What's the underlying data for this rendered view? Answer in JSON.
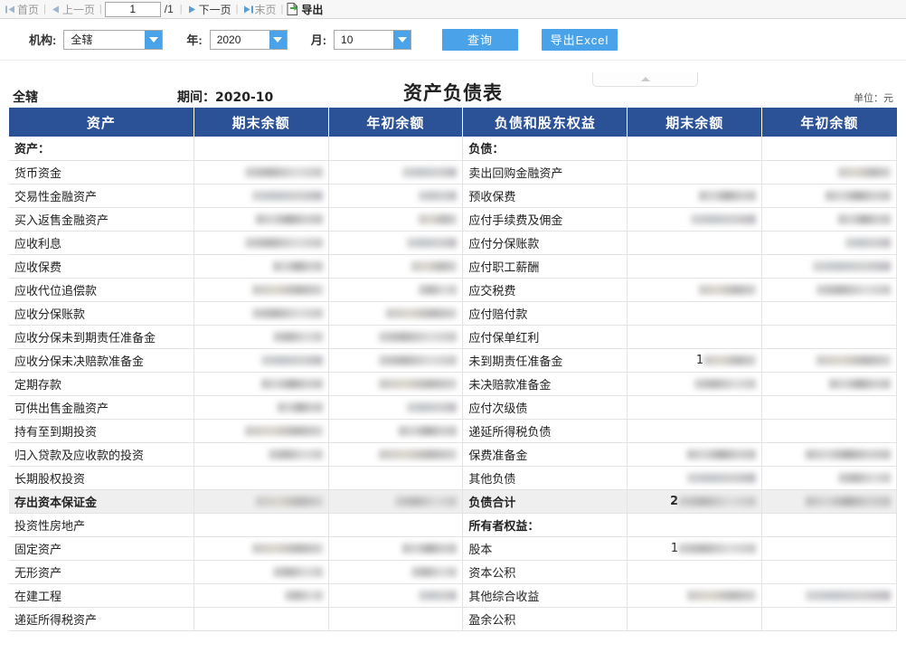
{
  "pager": {
    "first_label": "首页",
    "prev_label": "上一页",
    "page_value": "1",
    "total_pages": "/1",
    "next_label": "下一页",
    "last_label": "末页",
    "export_label": "导出"
  },
  "filters": {
    "org_label": "机构:",
    "org_value": "全辖",
    "year_label": "年:",
    "year_value": "2020",
    "month_label": "月:",
    "month_value": "10",
    "query_button": "查询",
    "export_excel_button": "导出Excel"
  },
  "report": {
    "org_name": "全辖",
    "period_label": "期间：2020-10",
    "title": "资产负债表",
    "unit_label": "单位：元",
    "columns": [
      "资产",
      "期末余额",
      "年初余额",
      "负债和股东权益",
      "期末余额",
      "年初余额"
    ],
    "rows": [
      {
        "asset": "资产：",
        "asset_type": "section",
        "a_end": "",
        "a_begin": "",
        "liab": "负债：",
        "liab_type": "section",
        "l_end": "",
        "l_begin": ""
      },
      {
        "asset": "货币资金",
        "asset_type": "item",
        "a_end": "redacted",
        "a_begin": "redacted",
        "liab": "卖出回购金融资产",
        "liab_type": "item",
        "l_end": "",
        "l_begin": "redacted"
      },
      {
        "asset": "交易性金融资产",
        "asset_type": "item",
        "a_end": "redacted",
        "a_begin": "redacted",
        "liab": "预收保费",
        "liab_type": "item",
        "l_end": "redacted",
        "l_begin": "redacted"
      },
      {
        "asset": "买入返售金融资产",
        "asset_type": "item",
        "a_end": "redacted",
        "a_begin": "redacted",
        "liab": "应付手续费及佣金",
        "liab_type": "item",
        "l_end": "redacted",
        "l_begin": "redacted"
      },
      {
        "asset": "应收利息",
        "asset_type": "item",
        "a_end": "redacted",
        "a_begin": "redacted",
        "liab": "应付分保账款",
        "liab_type": "item",
        "l_end": "",
        "l_begin": "redacted"
      },
      {
        "asset": "应收保费",
        "asset_type": "item",
        "a_end": "redacted",
        "a_begin": "redacted",
        "liab": "应付职工薪酬",
        "liab_type": "item",
        "l_end": "",
        "l_begin": "redacted"
      },
      {
        "asset": "应收代位追偿款",
        "asset_type": "item",
        "a_end": "redacted",
        "a_begin": "redacted",
        "liab": "应交税费",
        "liab_type": "item",
        "l_end": "redacted",
        "l_begin": "redacted"
      },
      {
        "asset": "应收分保账款",
        "asset_type": "item",
        "a_end": "redacted",
        "a_begin": "redacted",
        "liab": "应付赔付款",
        "liab_type": "item",
        "l_end": "",
        "l_begin": ""
      },
      {
        "asset": "应收分保未到期责任准备金",
        "asset_type": "item",
        "a_end": "redacted",
        "a_begin": "redacted",
        "liab": "应付保单红利",
        "liab_type": "item",
        "l_end": "",
        "l_begin": ""
      },
      {
        "asset": "应收分保未决赔款准备金",
        "asset_type": "item",
        "a_end": "redacted",
        "a_begin": "redacted",
        "liab": "未到期责任准备金",
        "liab_type": "item",
        "l_end": "redacted",
        "l_begin": "redacted",
        "l_end_lead": "1"
      },
      {
        "asset": "定期存款",
        "asset_type": "item",
        "a_end": "redacted",
        "a_begin": "redacted",
        "liab": "未决赔款准备金",
        "liab_type": "item",
        "l_end": "redacted",
        "l_begin": "redacted"
      },
      {
        "asset": "可供出售金融资产",
        "asset_type": "item",
        "a_end": "redacted",
        "a_begin": "redacted",
        "liab": "应付次级债",
        "liab_type": "item",
        "l_end": "",
        "l_begin": ""
      },
      {
        "asset": "持有至到期投资",
        "asset_type": "item",
        "a_end": "redacted",
        "a_begin": "redacted",
        "liab": "递延所得税负债",
        "liab_type": "item",
        "l_end": "",
        "l_begin": ""
      },
      {
        "asset": "归入贷款及应收款的投资",
        "asset_type": "item",
        "a_end": "redacted",
        "a_begin": "redacted",
        "liab": "保费准备金",
        "liab_type": "item",
        "l_end": "redacted",
        "l_begin": "redacted"
      },
      {
        "asset": "长期股权投资",
        "asset_type": "item",
        "a_end": "",
        "a_begin": "",
        "liab": "其他负债",
        "liab_type": "item",
        "l_end": "redacted",
        "l_begin": "redacted"
      },
      {
        "asset": "存出资本保证金",
        "asset_type": "item",
        "a_end": "redacted",
        "a_begin": "redacted",
        "liab": "负债合计",
        "liab_type": "total",
        "l_end": "redacted",
        "l_begin": "redacted",
        "l_end_lead": "2"
      },
      {
        "asset": "投资性房地产",
        "asset_type": "item",
        "a_end": "",
        "a_begin": "",
        "liab": "所有者权益：",
        "liab_type": "section",
        "l_end": "",
        "l_begin": ""
      },
      {
        "asset": "固定资产",
        "asset_type": "item",
        "a_end": "redacted",
        "a_begin": "redacted",
        "liab": "股本",
        "liab_type": "item",
        "l_end": "redacted",
        "l_begin": "",
        "l_end_lead": "1"
      },
      {
        "asset": "无形资产",
        "asset_type": "item",
        "a_end": "redacted",
        "a_begin": "redacted",
        "liab": "资本公积",
        "liab_type": "item",
        "l_end": "",
        "l_begin": ""
      },
      {
        "asset": "在建工程",
        "asset_type": "item",
        "a_end": "redacted",
        "a_begin": "redacted",
        "liab": "其他综合收益",
        "liab_type": "item",
        "l_end": "redacted",
        "l_begin": "redacted"
      },
      {
        "asset": "递延所得税资产",
        "asset_type": "item",
        "a_end": "",
        "a_begin": "",
        "liab": "盈余公积",
        "liab_type": "item",
        "l_end": "",
        "l_begin": ""
      }
    ]
  },
  "colors": {
    "header_blue": "#2b5197",
    "button_blue": "#4aa3e8",
    "total_row_bg": "#efefef"
  }
}
